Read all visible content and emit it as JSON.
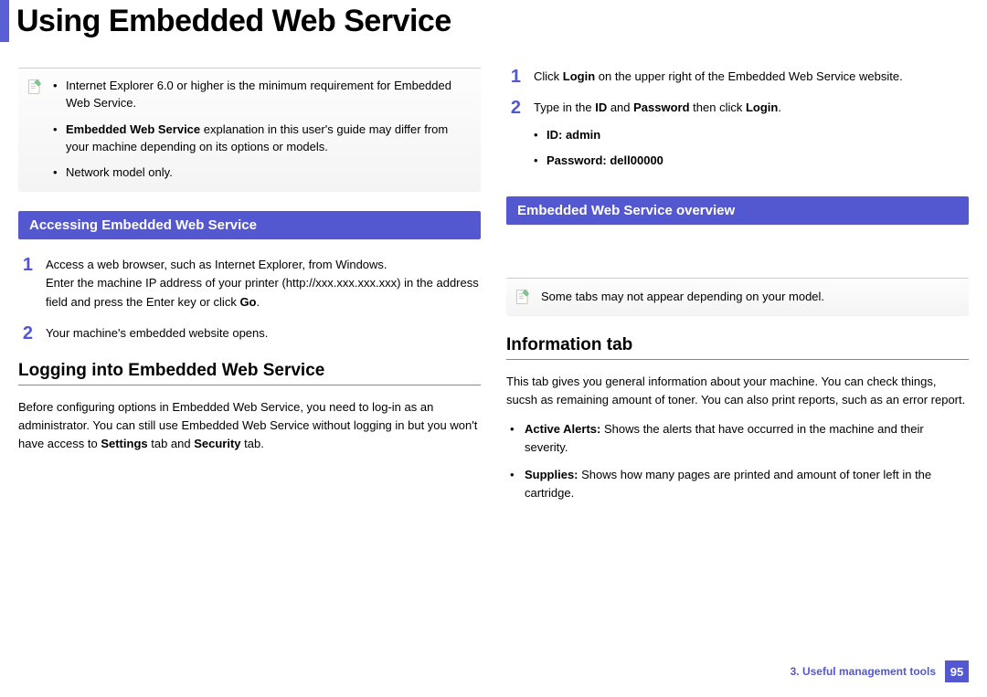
{
  "page_title": "Using Embedded Web Service",
  "left": {
    "note": {
      "items_html": [
        "Internet Explorer 6.0 or higher is the minimum requirement for Embedded Web Service.",
        "<b>Embedded Web Service</b> explanation in this user's guide may differ from your machine depending on its options or models.",
        "Network model only."
      ]
    },
    "section_accessing": {
      "title": "Accessing Embedded Web Service",
      "steps_html": [
        "Access a web browser, such as Internet Explorer, from Windows.<p>Enter the machine IP address of your printer (http://xxx.xxx.xxx.xxx) in the address field and press the Enter key or click <b>Go</b>.</p>",
        "Your machine's embedded website opens."
      ]
    },
    "subhead_logging": "Logging into Embedded Web Service",
    "logging_para_html": "Before configuring options in Embedded Web Service, you need to log-in as an administrator. You can still use Embedded Web Service without logging in but you won't have access to <b>Settings</b> tab and <b>Security</b> tab."
  },
  "right": {
    "steps_html": [
      "Click <b>Login</b> on the upper right of the Embedded Web Service website.",
      "Type in the <b>ID</b> and <b>Password</b> then click <b>Login</b>.<ul class='sub-bullets'><li><b>ID: admin</b></li><li><b>Password: dell00000</b></li></ul>"
    ],
    "section_overview": {
      "title": "Embedded Web Service overview"
    },
    "note_overview_html": "Some tabs may not appear depending on your model.",
    "subhead_info": "Information tab",
    "info_para": "This tab gives you general information about your machine. You can check things, sucsh as remaining amount of toner. You can also print reports, such as an error report.",
    "info_bullets_html": [
      "<b>Active Alerts:</b> Shows the alerts that have occurred in the machine and their severity.",
      "<b>Supplies:</b> Shows how many pages are printed and amount of toner left in the cartridge."
    ]
  },
  "footer": {
    "chapter": "3.  Useful management tools",
    "page": "95"
  },
  "icons": {
    "note": "note-icon"
  }
}
